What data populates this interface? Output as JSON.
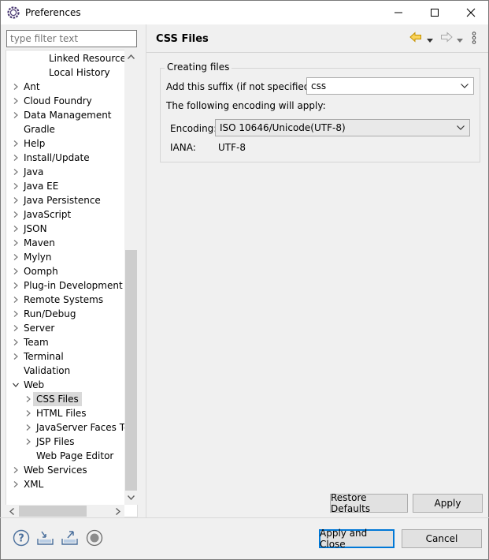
{
  "window": {
    "title": "Preferences"
  },
  "filter": {
    "placeholder": "type filter text"
  },
  "tree": {
    "items": [
      {
        "label": "Linked Resources",
        "indent": 2,
        "twisty": false
      },
      {
        "label": "Local History",
        "indent": 2,
        "twisty": false
      },
      {
        "label": "Ant",
        "indent": 0,
        "twisty": "collapsed"
      },
      {
        "label": "Cloud Foundry",
        "indent": 0,
        "twisty": "collapsed"
      },
      {
        "label": "Data Management",
        "indent": 0,
        "twisty": "collapsed"
      },
      {
        "label": "Gradle",
        "indent": 0,
        "twisty": false
      },
      {
        "label": "Help",
        "indent": 0,
        "twisty": "collapsed"
      },
      {
        "label": "Install/Update",
        "indent": 0,
        "twisty": "collapsed"
      },
      {
        "label": "Java",
        "indent": 0,
        "twisty": "collapsed"
      },
      {
        "label": "Java EE",
        "indent": 0,
        "twisty": "collapsed"
      },
      {
        "label": "Java Persistence",
        "indent": 0,
        "twisty": "collapsed"
      },
      {
        "label": "JavaScript",
        "indent": 0,
        "twisty": "collapsed"
      },
      {
        "label": "JSON",
        "indent": 0,
        "twisty": "collapsed"
      },
      {
        "label": "Maven",
        "indent": 0,
        "twisty": "collapsed"
      },
      {
        "label": "Mylyn",
        "indent": 0,
        "twisty": "collapsed"
      },
      {
        "label": "Oomph",
        "indent": 0,
        "twisty": "collapsed"
      },
      {
        "label": "Plug-in Development",
        "indent": 0,
        "twisty": "collapsed"
      },
      {
        "label": "Remote Systems",
        "indent": 0,
        "twisty": "collapsed"
      },
      {
        "label": "Run/Debug",
        "indent": 0,
        "twisty": "collapsed"
      },
      {
        "label": "Server",
        "indent": 0,
        "twisty": "collapsed"
      },
      {
        "label": "Team",
        "indent": 0,
        "twisty": "collapsed"
      },
      {
        "label": "Terminal",
        "indent": 0,
        "twisty": "collapsed"
      },
      {
        "label": "Validation",
        "indent": 0,
        "twisty": false
      },
      {
        "label": "Web",
        "indent": 0,
        "twisty": "expanded"
      },
      {
        "label": "CSS Files",
        "indent": 1,
        "twisty": "collapsed",
        "selected": true
      },
      {
        "label": "HTML Files",
        "indent": 1,
        "twisty": "collapsed"
      },
      {
        "label": "JavaServer Faces Too",
        "indent": 1,
        "twisty": "collapsed"
      },
      {
        "label": "JSP Files",
        "indent": 1,
        "twisty": "collapsed"
      },
      {
        "label": "Web Page Editor",
        "indent": 1,
        "twisty": false
      },
      {
        "label": "Web Services",
        "indent": 0,
        "twisty": "collapsed"
      },
      {
        "label": "XML",
        "indent": 0,
        "twisty": "collapsed"
      }
    ]
  },
  "page": {
    "title": "CSS Files",
    "group_title": "Creating files",
    "suffix_label": "Add this suffix (if not specified):",
    "suffix_value": "css",
    "encoding_note": "The following encoding will apply:",
    "encoding_label": "Encoding:",
    "encoding_value": "ISO 10646/Unicode(UTF-8)",
    "iana_label": "IANA:",
    "iana_value": "UTF-8"
  },
  "buttons": {
    "restore_defaults": "Restore Defaults",
    "apply": "Apply",
    "apply_and_close": "Apply and Close",
    "cancel": "Cancel"
  },
  "colors": {
    "accent": "#0078d7",
    "back_arrow": "#e8b200"
  }
}
